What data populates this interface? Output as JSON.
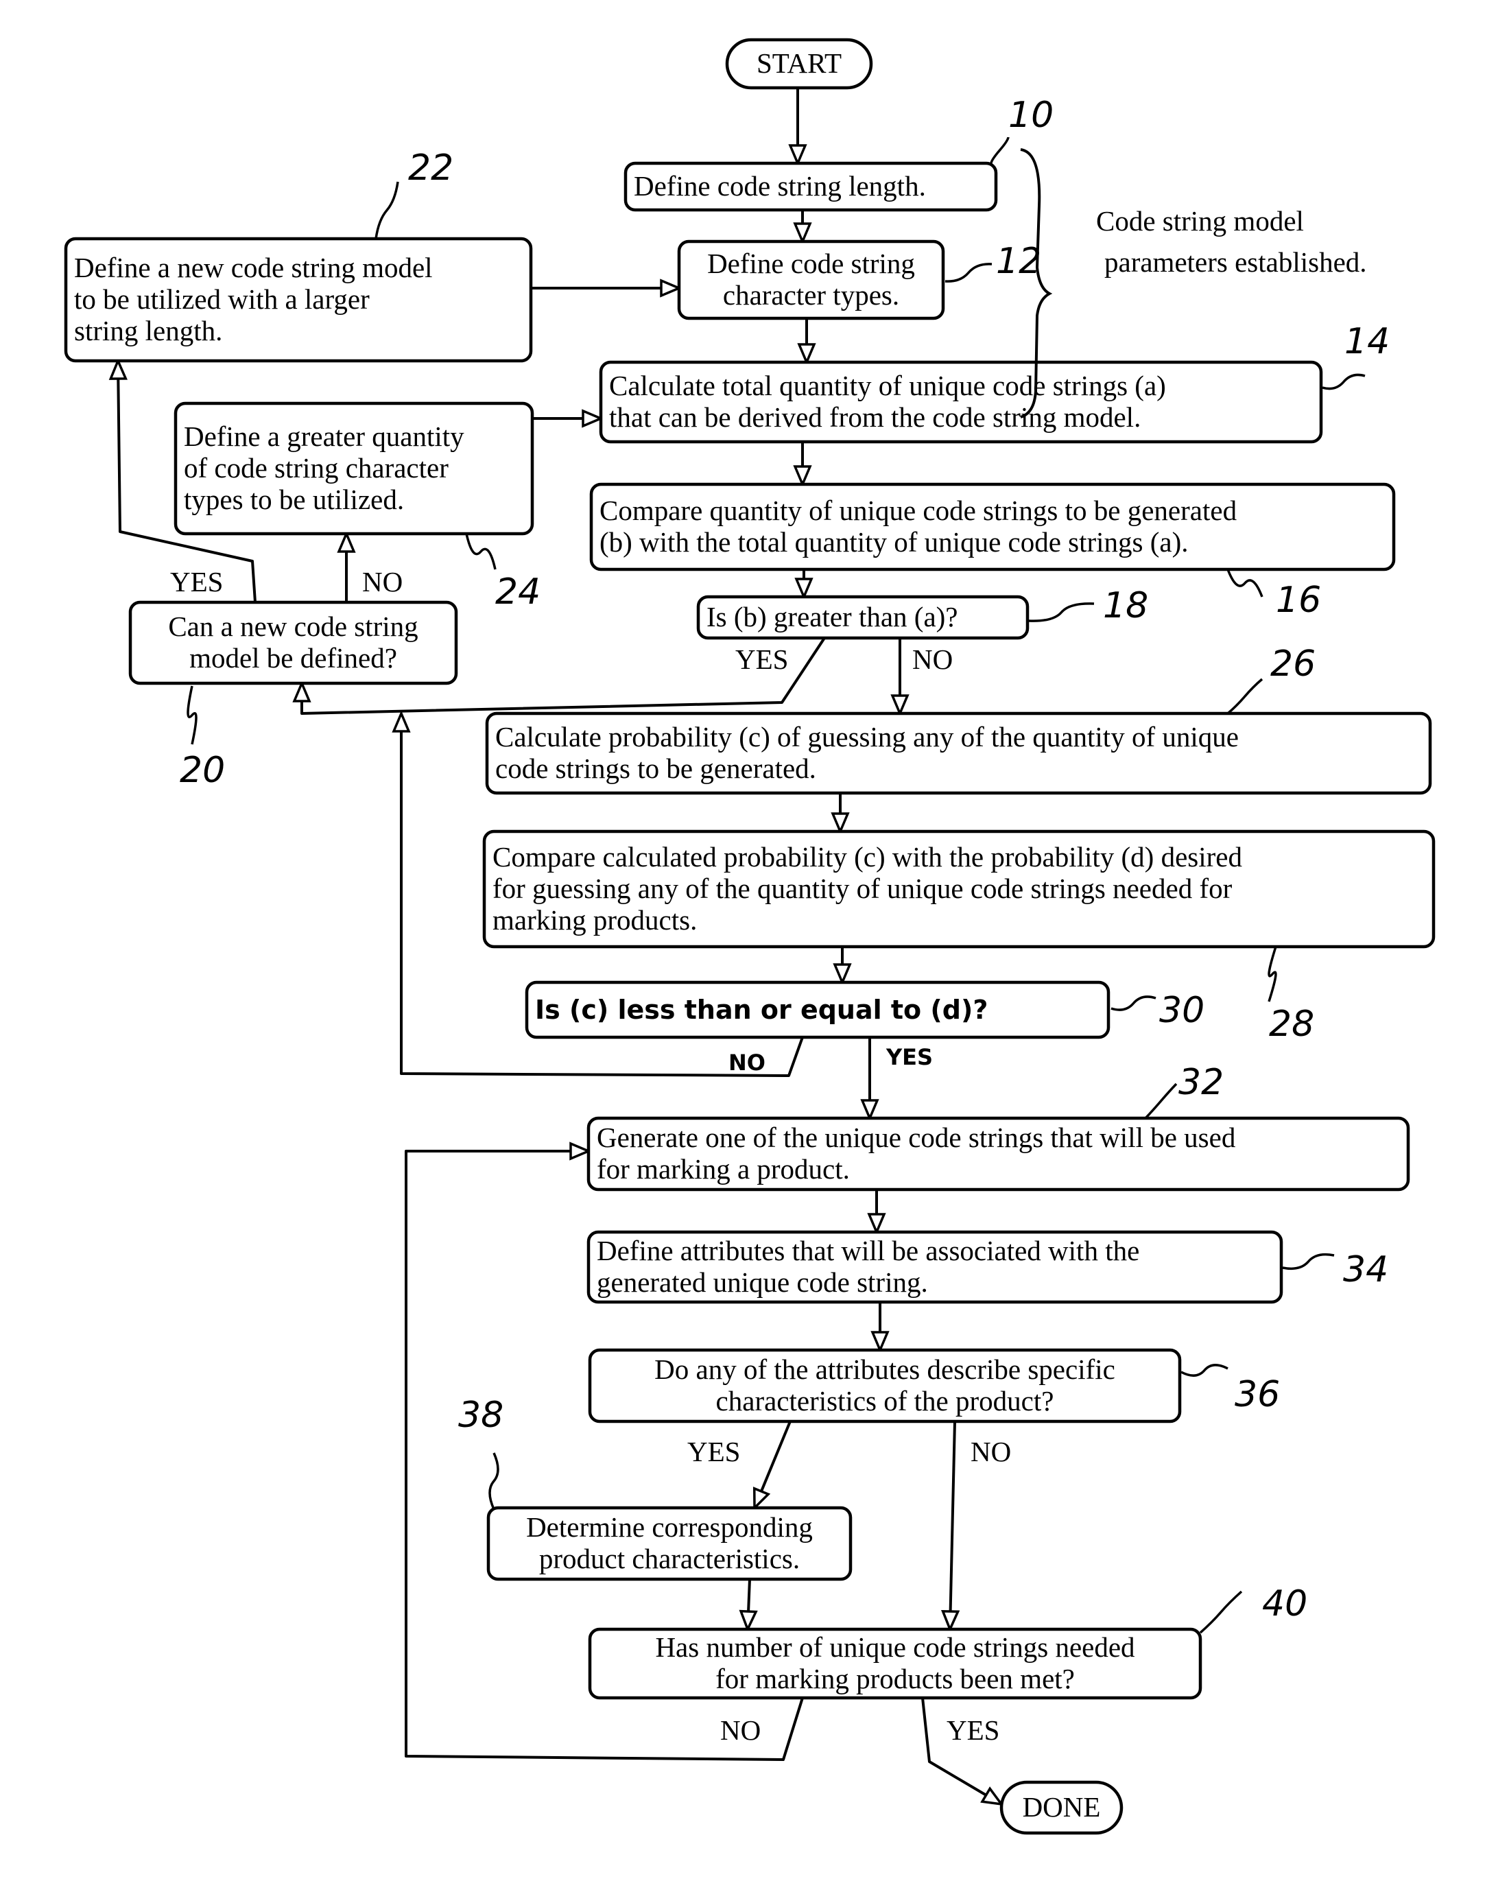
{
  "diagram": {
    "type": "flowchart",
    "nodes": [
      {
        "id": "start",
        "ref": "",
        "kind": "terminal",
        "lines": [
          "START"
        ]
      },
      {
        "id": "n10",
        "ref": "10",
        "kind": "process",
        "lines": [
          "Define code string length."
        ]
      },
      {
        "id": "n12",
        "ref": "12",
        "kind": "process",
        "lines": [
          "Define code string",
          "character types."
        ]
      },
      {
        "id": "n14",
        "ref": "14",
        "kind": "process",
        "lines": [
          "Calculate total quantity of unique code strings (a)",
          "that can be derived from the code string model."
        ]
      },
      {
        "id": "n16",
        "ref": "16",
        "kind": "process",
        "lines": [
          "Compare quantity of unique code strings to be generated",
          "(b) with the total quantity of unique code strings (a)."
        ]
      },
      {
        "id": "n18",
        "ref": "18",
        "kind": "decision",
        "lines": [
          "Is (b) greater than (a)?"
        ]
      },
      {
        "id": "n20",
        "ref": "20",
        "kind": "decision",
        "lines": [
          "Can a new code string",
          "model be defined?"
        ]
      },
      {
        "id": "n22",
        "ref": "22",
        "kind": "process",
        "lines": [
          "Define a new code string model",
          "to be utilized with a larger",
          "string length."
        ]
      },
      {
        "id": "n24",
        "ref": "24",
        "kind": "process",
        "lines": [
          "Define a greater quantity",
          "of code string character",
          "types to be utilized."
        ]
      },
      {
        "id": "n26",
        "ref": "26",
        "kind": "process",
        "lines": [
          "Calculate probability (c) of guessing any of the quantity of unique",
          "code strings to be generated."
        ]
      },
      {
        "id": "n28",
        "ref": "28",
        "kind": "process",
        "lines": [
          "Compare calculated probability (c) with the probability (d) desired",
          "for guessing any of the quantity of unique code strings needed for",
          "marking products."
        ]
      },
      {
        "id": "n30",
        "ref": "30",
        "kind": "decision",
        "lines": [
          "Is (c) less than or equal to (d)?"
        ]
      },
      {
        "id": "n32",
        "ref": "32",
        "kind": "process",
        "lines": [
          "Generate one of the unique code strings that will be used",
          "for marking a product."
        ]
      },
      {
        "id": "n34",
        "ref": "34",
        "kind": "process",
        "lines": [
          "Define attributes that will be associated with the",
          "generated unique code string."
        ]
      },
      {
        "id": "n36",
        "ref": "36",
        "kind": "decision",
        "lines": [
          "Do any of the attributes describe specific",
          "characteristics of the product?"
        ]
      },
      {
        "id": "n38",
        "ref": "38",
        "kind": "process",
        "lines": [
          "Determine corresponding",
          "product characteristics."
        ]
      },
      {
        "id": "n40",
        "ref": "40",
        "kind": "decision",
        "lines": [
          "Has number of unique code strings needed",
          "for marking products been met?"
        ]
      },
      {
        "id": "done",
        "ref": "",
        "kind": "terminal",
        "lines": [
          "DONE"
        ]
      }
    ],
    "edges": [
      {
        "from": "start",
        "to": "n10",
        "label": ""
      },
      {
        "from": "n10",
        "to": "n12",
        "label": ""
      },
      {
        "from": "n12",
        "to": "n14",
        "label": ""
      },
      {
        "from": "n14",
        "to": "n16",
        "label": ""
      },
      {
        "from": "n16",
        "to": "n18",
        "label": ""
      },
      {
        "from": "n18",
        "to": "n20",
        "label": "YES"
      },
      {
        "from": "n18",
        "to": "n26",
        "label": "NO"
      },
      {
        "from": "n20",
        "to": "n22",
        "label": "YES"
      },
      {
        "from": "n20",
        "to": "n24",
        "label": "NO"
      },
      {
        "from": "n22",
        "to": "n12",
        "label": ""
      },
      {
        "from": "n24",
        "to": "n14",
        "label": ""
      },
      {
        "from": "n26",
        "to": "n28",
        "label": ""
      },
      {
        "from": "n28",
        "to": "n30",
        "label": ""
      },
      {
        "from": "n30",
        "to": "n20",
        "label": "NO"
      },
      {
        "from": "n30",
        "to": "n32",
        "label": "YES"
      },
      {
        "from": "n32",
        "to": "n34",
        "label": ""
      },
      {
        "from": "n34",
        "to": "n36",
        "label": ""
      },
      {
        "from": "n36",
        "to": "n38",
        "label": "YES"
      },
      {
        "from": "n36",
        "to": "n40",
        "label": "NO"
      },
      {
        "from": "n38",
        "to": "n40",
        "label": ""
      },
      {
        "from": "n40",
        "to": "n32",
        "label": "NO"
      },
      {
        "from": "n40",
        "to": "done",
        "label": "YES"
      }
    ],
    "annotation": {
      "bracketed_nodes": [
        "n10",
        "n12"
      ],
      "lines": [
        "Code string model",
        "parameters established."
      ]
    }
  }
}
